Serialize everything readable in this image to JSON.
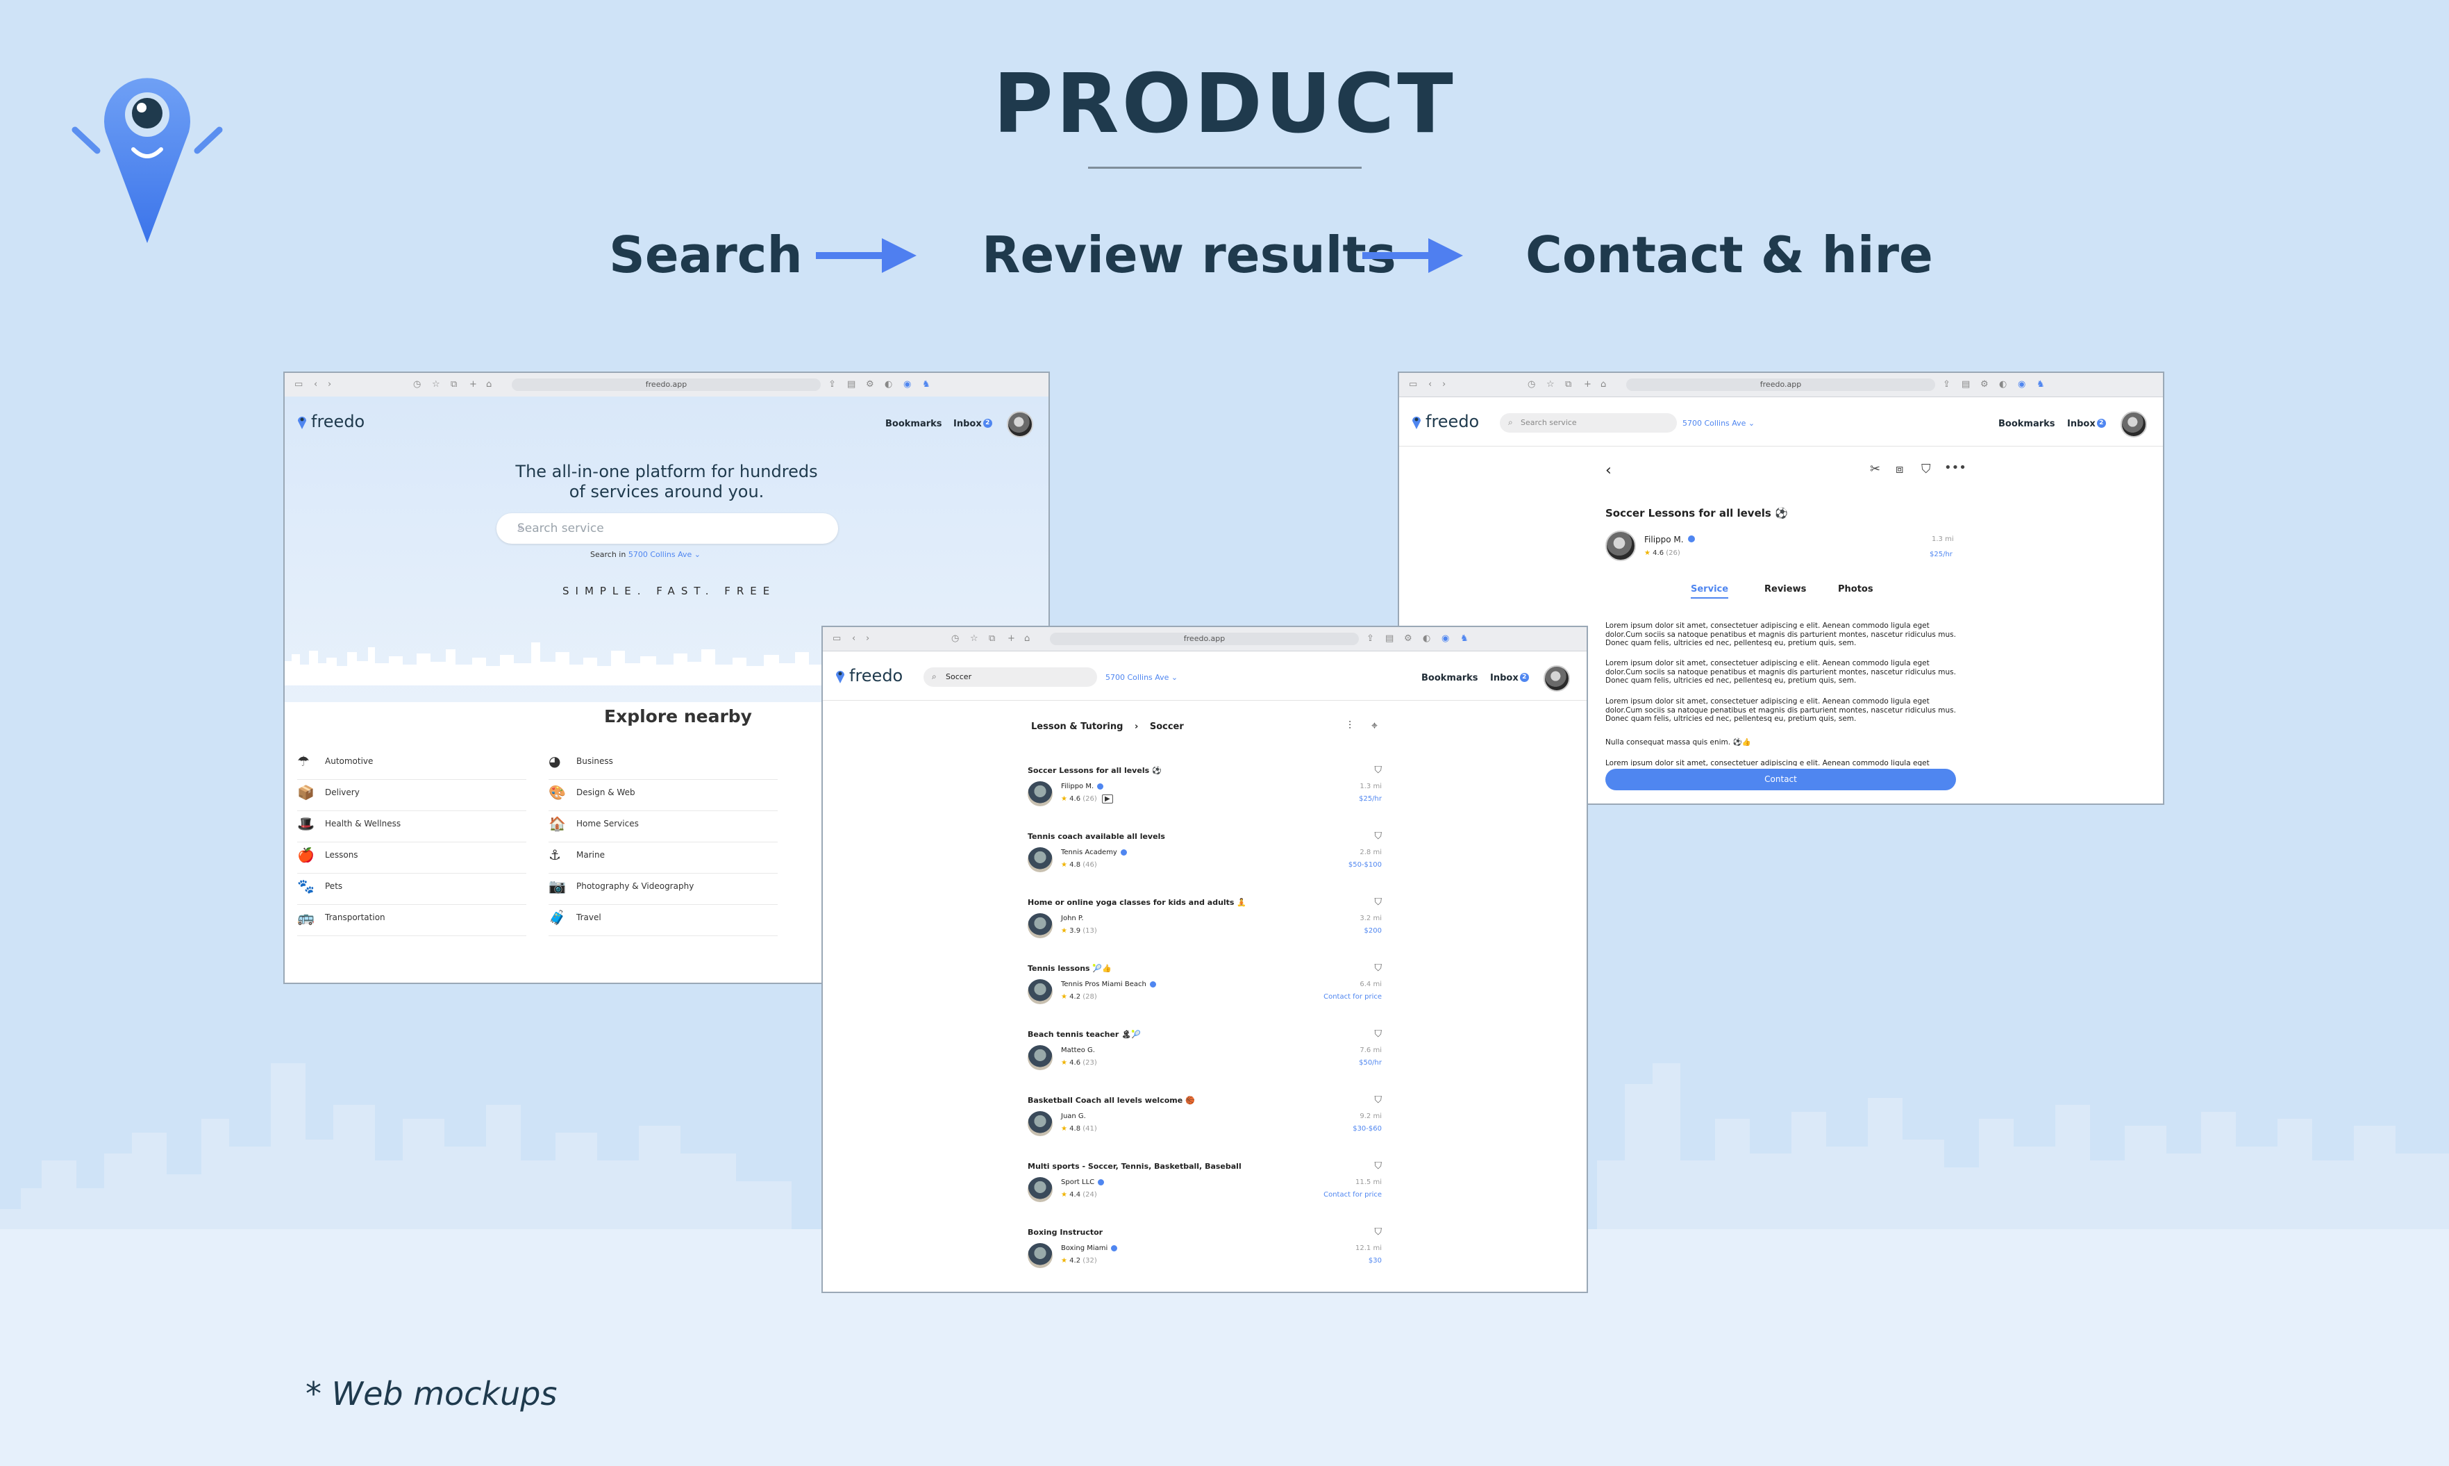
{
  "header": {
    "title": "PRODUCT",
    "steps": [
      "Search",
      "Review results",
      "Contact & hire"
    ],
    "footnote": "* Web mockups"
  },
  "colors": {
    "accent": "#4f86f0",
    "background": "#cfe3f7",
    "heading": "#1f3a4d"
  },
  "browser": {
    "url": "freedo.app"
  },
  "app": {
    "brand": "freedo",
    "bookmarks": "Bookmarks",
    "inbox": "Inbox",
    "inbox_count": "2",
    "location": "5700 Collins Ave"
  },
  "home": {
    "tagline_line1": "The all-in-one platform for hundreds",
    "tagline_line2": "of services around you.",
    "search_placeholder": "Search service",
    "search_in": "Search in",
    "slogan": "SIMPLE. FAST. FREE",
    "explore_title": "Explore nearby",
    "categories_col1": [
      {
        "icon": "umbrella-icon",
        "glyph": "☂",
        "label": "Automotive"
      },
      {
        "icon": "package-icon",
        "glyph": "📦",
        "label": "Delivery"
      },
      {
        "icon": "top-hat-icon",
        "glyph": "🎩",
        "label": "Health & Wellness"
      },
      {
        "icon": "apple-icon",
        "glyph": "🍎",
        "label": "Lessons"
      },
      {
        "icon": "paw-icon",
        "glyph": "🐾",
        "label": "Pets"
      },
      {
        "icon": "bus-icon",
        "glyph": "🚌",
        "label": "Transportation"
      }
    ],
    "categories_col2": [
      {
        "icon": "pie-chart-icon",
        "glyph": "◕",
        "label": "Business"
      },
      {
        "icon": "palette-icon",
        "glyph": "🎨",
        "label": "Design & Web"
      },
      {
        "icon": "house-icon",
        "glyph": "🏠",
        "label": "Home Services"
      },
      {
        "icon": "anchor-icon",
        "glyph": "⚓",
        "label": "Marine"
      },
      {
        "icon": "camera-icon",
        "glyph": "📷",
        "label": "Photography & Videography"
      },
      {
        "icon": "luggage-icon",
        "glyph": "🧳",
        "label": "Travel"
      }
    ]
  },
  "results": {
    "search_value": "Soccer",
    "breadcrumb_parent": "Lesson & Tutoring",
    "breadcrumb_current": "Soccer",
    "items": [
      {
        "title": "Soccer Lessons for all levels ⚽",
        "name": "Filippo M.",
        "rating": "4.6",
        "count": "(26)",
        "distance": "1.3 mi",
        "price": "$25/hr"
      },
      {
        "title": "Tennis coach available all levels",
        "name": "Tennis Academy",
        "rating": "4.8",
        "count": "(46)",
        "distance": "2.8 mi",
        "price": "$50-$100"
      },
      {
        "title": "Home or online yoga classes for kids and adults 🧘",
        "name": "John P.",
        "rating": "3.9",
        "count": "(13)",
        "distance": "3.2 mi",
        "price": "$200"
      },
      {
        "title": "Tennis lessons 🎾👍",
        "name": "Tennis Pros Miami Beach",
        "rating": "4.2",
        "count": "(28)",
        "distance": "6.4 mi",
        "price": "Contact for price"
      },
      {
        "title": "Beach tennis teacher 🏝🎾",
        "name": "Matteo G.",
        "rating": "4.6",
        "count": "(23)",
        "distance": "7.6 mi",
        "price": "$50/hr"
      },
      {
        "title": "Basketball Coach all levels welcome 🏀",
        "name": "Juan G.",
        "rating": "4.8",
        "count": "(41)",
        "distance": "9.2 mi",
        "price": "$30-$60"
      },
      {
        "title": "Multi sports - Soccer, Tennis, Basketball, Baseball",
        "name": "Sport LLC",
        "rating": "4.4",
        "count": "(24)",
        "distance": "11.5 mi",
        "price": "Contact for price"
      },
      {
        "title": "Boxing Instructor",
        "name": "Boxing Miami",
        "rating": "4.2",
        "count": "(32)",
        "distance": "12.1 mi",
        "price": "$30"
      }
    ]
  },
  "detail": {
    "title": "Soccer Lessons for all levels ⚽",
    "provider": "Filippo M.",
    "rating": "4.6",
    "count": "(26)",
    "distance": "1.3 mi",
    "price": "$25/hr",
    "tabs": [
      "Service",
      "Reviews",
      "Photos"
    ],
    "paragraphs": [
      "Lorem ipsum dolor sit amet, consectetuer adipiscing e elit. Aenean commodo ligula eget dolor.Cum sociis sa natoque penatibus et magnis dis parturient montes, nascetur ridiculus mus. Donec quam felis, ultricies ed nec, pellentesq eu, pretium quis, sem.",
      "Lorem ipsum dolor sit amet, consectetuer adipiscing e elit. Aenean commodo ligula eget dolor.Cum sociis sa natoque penatibus et magnis dis parturient montes, nascetur ridiculus mus. Donec quam felis, ultricies ed nec, pellentesq eu, pretium quis, sem.",
      "Lorem ipsum dolor sit amet, consectetuer adipiscing e elit. Aenean commodo ligula eget dolor.Cum sociis sa natoque penatibus et magnis dis parturient montes, nascetur ridiculus mus. Donec quam felis, ultricies ed nec, pellentesq eu, pretium quis, sem.",
      "Nulla consequat massa quis enim. ⚽👍"
    ],
    "contact": "Contact"
  }
}
